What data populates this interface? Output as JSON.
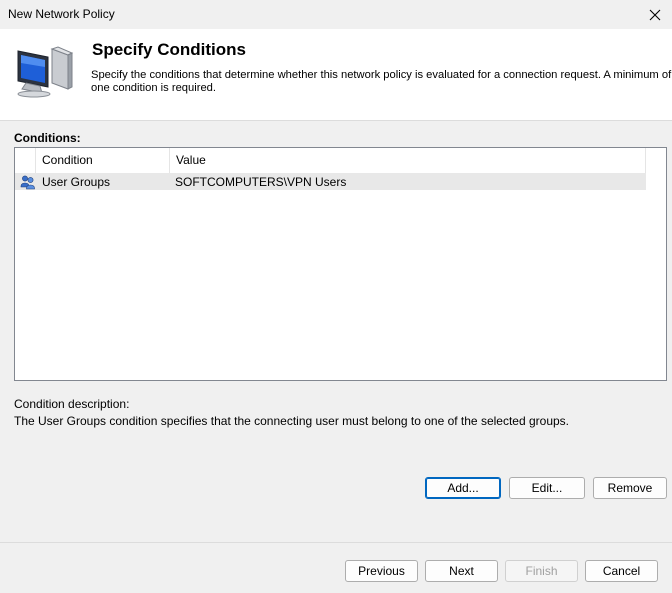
{
  "window": {
    "title": "New Network Policy",
    "close_icon": "close-icon"
  },
  "header": {
    "heading": "Specify Conditions",
    "description": "Specify the conditions that determine whether this network policy is evaluated for a connection request. A minimum of one condition is required.",
    "icon": "monitor-icon"
  },
  "conditions": {
    "label": "Conditions:",
    "columns": [
      "Condition",
      "Value"
    ],
    "rows": [
      {
        "icon": "user-group-icon",
        "condition": "User Groups",
        "value": "SOFTCOMPUTERS\\VPN Users"
      }
    ]
  },
  "description": {
    "label": "Condition description:",
    "text": "The User Groups condition specifies that the connecting user must belong to one of the selected groups."
  },
  "actions": {
    "add": "Add...",
    "edit": "Edit...",
    "remove": "Remove"
  },
  "wizard": {
    "previous": "Previous",
    "next": "Next",
    "finish": "Finish",
    "cancel": "Cancel"
  },
  "colors": {
    "accent": "#0067c0",
    "row_highlight": "#e8e8e8"
  }
}
